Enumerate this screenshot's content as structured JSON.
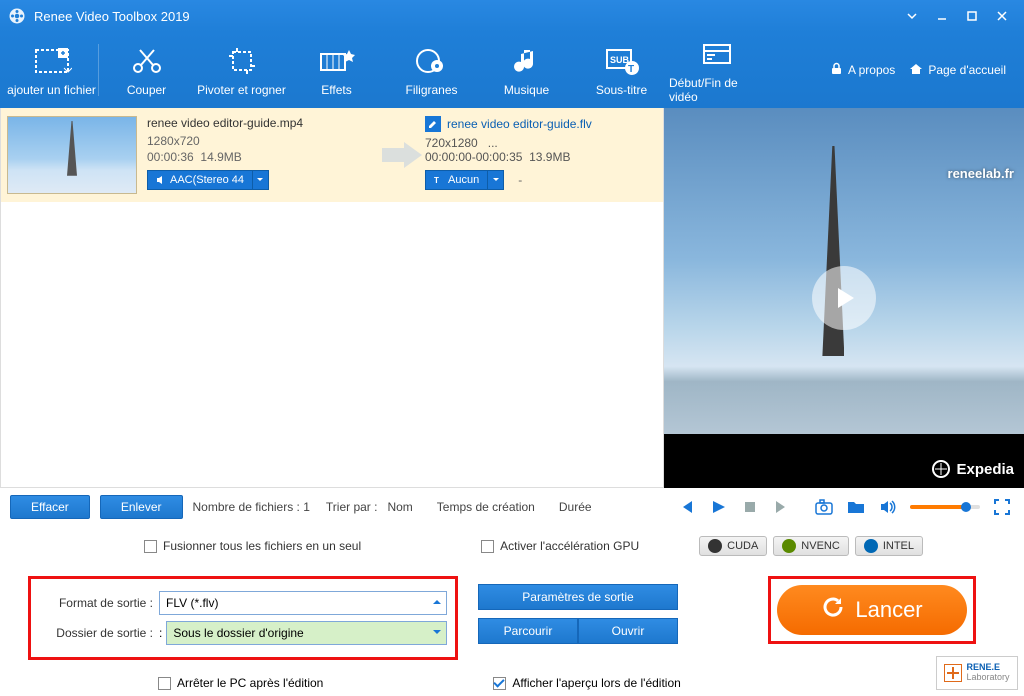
{
  "titlebar": {
    "title": "Renee Video Toolbox 2019"
  },
  "toolbar": {
    "items": [
      "ajouter un fichier",
      "Couper",
      "Pivoter et rogner",
      "Effets",
      "Filigranes",
      "Musique",
      "Sous-titre",
      "Début/Fin de vidéo"
    ],
    "about": "A propos",
    "home": "Page d'accueil"
  },
  "file": {
    "in_name": "renee video editor-guide.mp4",
    "in_res": "1280x720",
    "in_time": "00:00:36",
    "in_size": "14.9MB",
    "out_name": "renee video editor-guide.flv",
    "out_res": "720x1280",
    "out_dots": "...",
    "out_time": "00:00:00-00:00:35",
    "out_size": "13.9MB",
    "audio_sel": "AAC(Stereo 44",
    "sub_sel": "Aucun",
    "dash": "-"
  },
  "preview": {
    "watermark": "reneelab.fr",
    "brand": "Expedia"
  },
  "list_footer": {
    "clear": "Effacer",
    "remove": "Enlever",
    "count": "Nombre de fichiers : 1",
    "sort_by": "Trier par :",
    "name": "Nom",
    "ctime": "Temps de création",
    "duration": "Durée"
  },
  "settings": {
    "merge": "Fusionner tous les fichiers en un seul",
    "gpu": "Activer l'accélération GPU",
    "gpu_cuda": "CUDA",
    "gpu_nvenc": "NVENC",
    "gpu_intel": "INTEL",
    "output_format_label": "Format de sortie :",
    "output_format_value": "FLV (*.flv)",
    "output_folder_label": "Dossier de sortie :",
    "output_folder_sep": ":",
    "output_folder_value": "Sous le dossier d'origine",
    "params": "Paramètres de sortie",
    "browse": "Parcourir",
    "open": "Ouvrir",
    "shutdown": "Arrêter le PC après l'édition",
    "preview_check": "Afficher l'aperçu lors de l'édition",
    "launch": "Lancer"
  },
  "brand_badge": {
    "line1": "RENE.E",
    "line2": "Laboratory"
  }
}
